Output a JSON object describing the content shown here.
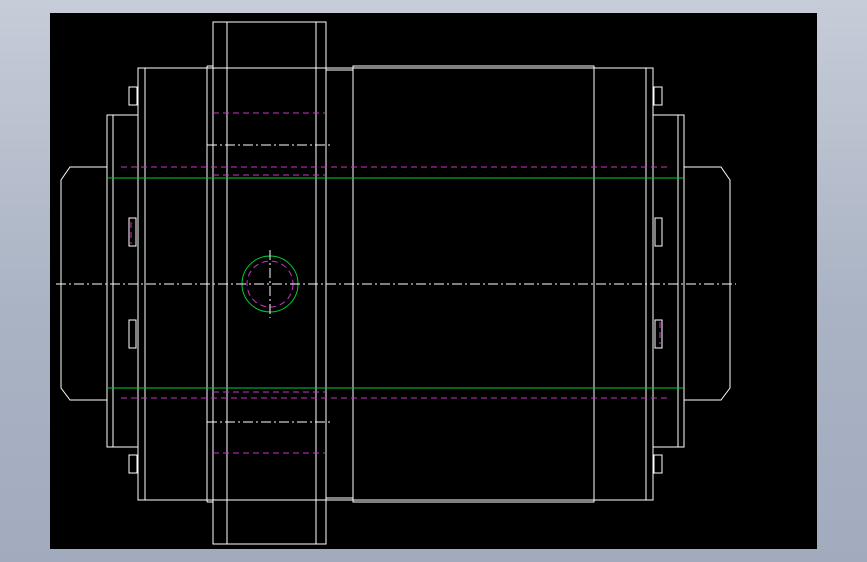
{
  "drawing": {
    "background": "#000000",
    "frame_gradient": [
      "#c6ccd8",
      "#a2abbe"
    ],
    "colors": {
      "outline": "#ffffff",
      "hidden": "#cc33cc",
      "pitch": "#00cc33",
      "centerline": "#ffffff"
    },
    "views": [
      "front-view"
    ],
    "features": [
      "outer-body",
      "flange",
      "left-shaft",
      "right-shaft",
      "cross-hole",
      "bolt-heads"
    ]
  }
}
